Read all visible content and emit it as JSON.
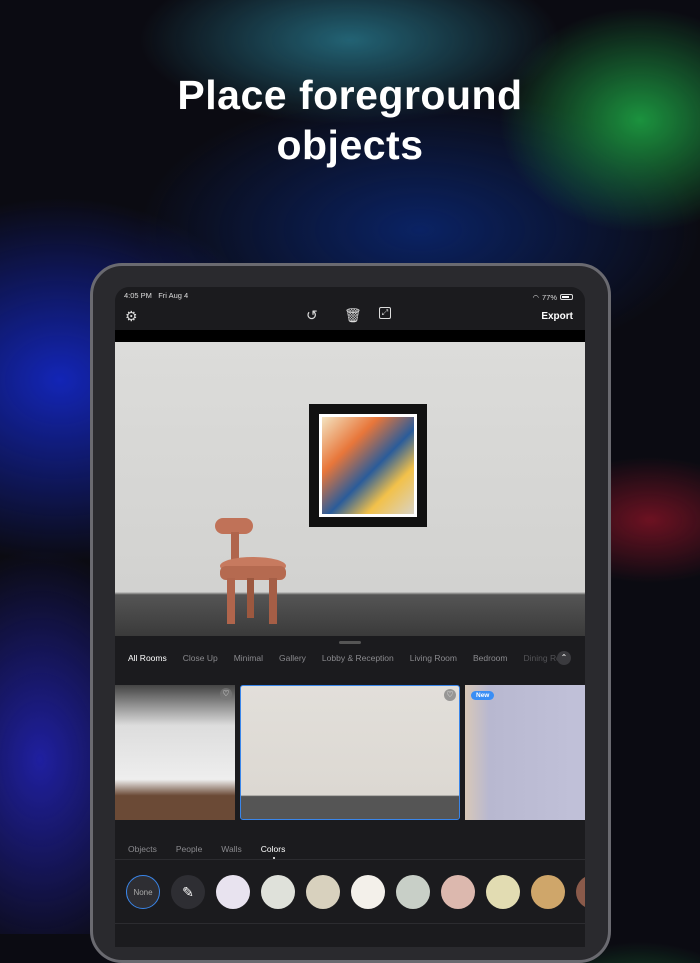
{
  "headline": {
    "line1": "Place foreground",
    "line2": "objects"
  },
  "status": {
    "time": "4:05 PM",
    "date": "Fri Aug 4",
    "battery": "77%",
    "battery_fraction": 0.77
  },
  "toolbar": {
    "export_label": "Export",
    "icons": [
      "gear-icon",
      "undo-icon",
      "trash-icon",
      "resize-icon"
    ]
  },
  "room_tabs": [
    "All Rooms",
    "Close Up",
    "Minimal",
    "Gallery",
    "Lobby & Reception",
    "Living Room",
    "Bedroom",
    "Dining Ro"
  ],
  "thumbnails": {
    "new_badge": "New"
  },
  "sub_tabs": [
    "Objects",
    "People",
    "Walls",
    "Colors"
  ],
  "colors": {
    "none_label": "None",
    "swatches": [
      "#e8e3ef",
      "#dfe1da",
      "#d8d1be",
      "#f3f0ea",
      "#c8cfc7",
      "#dcb8ae",
      "#e2dcb2",
      "#cfa66a",
      "#8a5a4a"
    ]
  }
}
